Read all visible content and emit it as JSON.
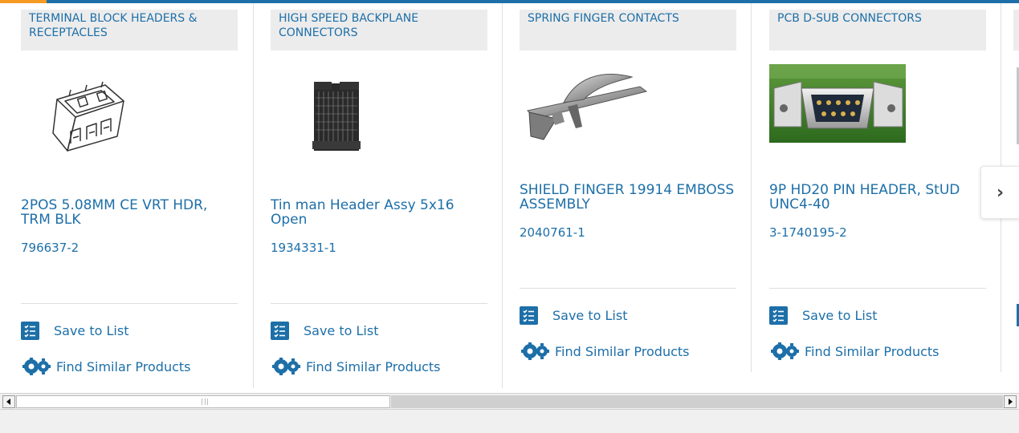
{
  "colors": {
    "link": "#1d6fa8",
    "category_bg": "#ececec",
    "accent": "#f59a23"
  },
  "cards": [
    {
      "category": "TERMINAL BLOCK HEADERS & RECEPTACLES",
      "title": "2POS 5.08MM CE VRT HDR, TRM BLK",
      "part_number": "796637-2",
      "image_icon": "terminal-block-image",
      "save_label": "Save to List",
      "find_label": "Find Similar Products"
    },
    {
      "category": "HIGH SPEED BACKPLANE CONNECTORS",
      "title": "Tin man Header Assy 5x16 Open",
      "part_number": "1934331-1",
      "image_icon": "backplane-connector-image",
      "save_label": "Save to List",
      "find_label": "Find Similar Products"
    },
    {
      "category": "SPRING FINGER CONTACTS",
      "title": "SHIELD FINGER 19914 EMBOSS ASSEMBLY",
      "part_number": "2040761-1",
      "image_icon": "spring-finger-image",
      "save_label": "Save to List",
      "find_label": "Find Similar Products"
    },
    {
      "category": "PCB D-SUB CONNECTORS",
      "title": "9P HD20 PIN HEADER, StUD UNC4-40",
      "part_number": "3-1740195-2",
      "image_icon": "dsub-connector-image",
      "save_label": "Save to List",
      "find_label": "Find Similar Products"
    }
  ],
  "carousel": {
    "next_icon": "chevron-right-icon",
    "next_glyph": "›"
  },
  "scrollbar": {
    "left_icon": "scroll-left-arrow-icon",
    "right_icon": "scroll-right-arrow-icon"
  }
}
